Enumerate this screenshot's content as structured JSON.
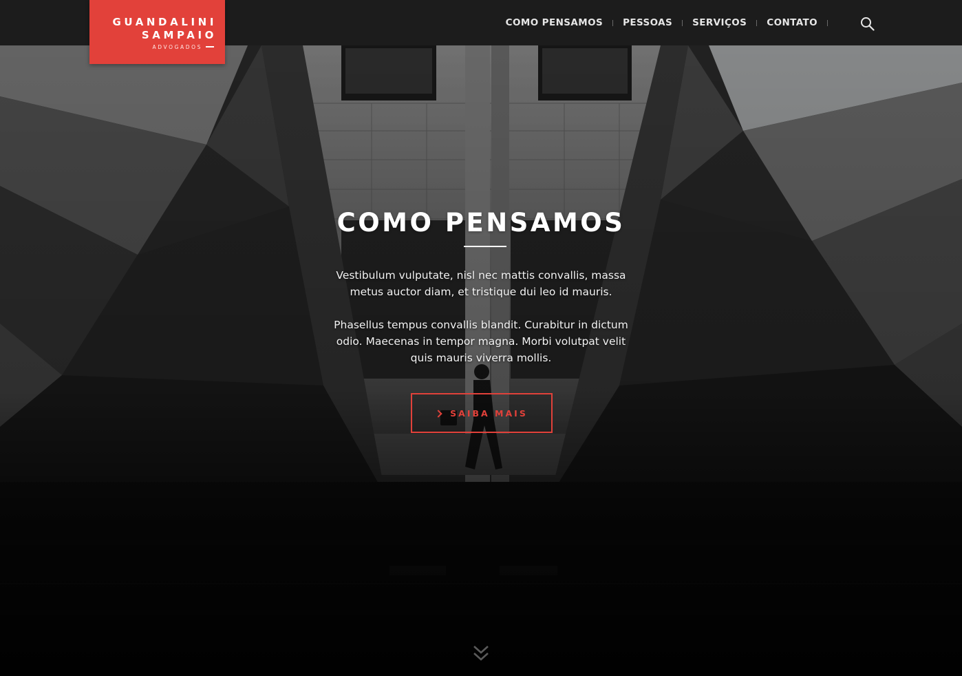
{
  "brand": {
    "line1": "GUANDALINI",
    "line2": "SAMPAIO",
    "line3": "ADVOGADOS",
    "accent_color": "#e2413a"
  },
  "nav": {
    "items": [
      {
        "label": "COMO PENSAMOS"
      },
      {
        "label": "PESSOAS"
      },
      {
        "label": "SERVIÇOS"
      },
      {
        "label": "CONTATO"
      }
    ],
    "search_icon": "search-icon"
  },
  "hero": {
    "title": "COMO PENSAMOS",
    "paragraph1": [
      "Vestibulum vulputate, nisl nec mattis convallis, massa",
      "metus auctor diam, et tristique dui leo id mauris."
    ],
    "paragraph2": [
      "Phasellus tempus convallis blandit. Curabitur in dictum",
      "odio. Maecenas in tempor magna. Morbi volutpat velit",
      "quis mauris viverra mollis."
    ],
    "cta_label": "SAIBA MAIS",
    "cta_icon": "chevron-right-icon",
    "scroll_icon": "double-chevron-down-icon"
  },
  "colors": {
    "header_bg": "#1c1c1c",
    "nav_text": "#e6e6e6",
    "accent": "#e2413a"
  }
}
